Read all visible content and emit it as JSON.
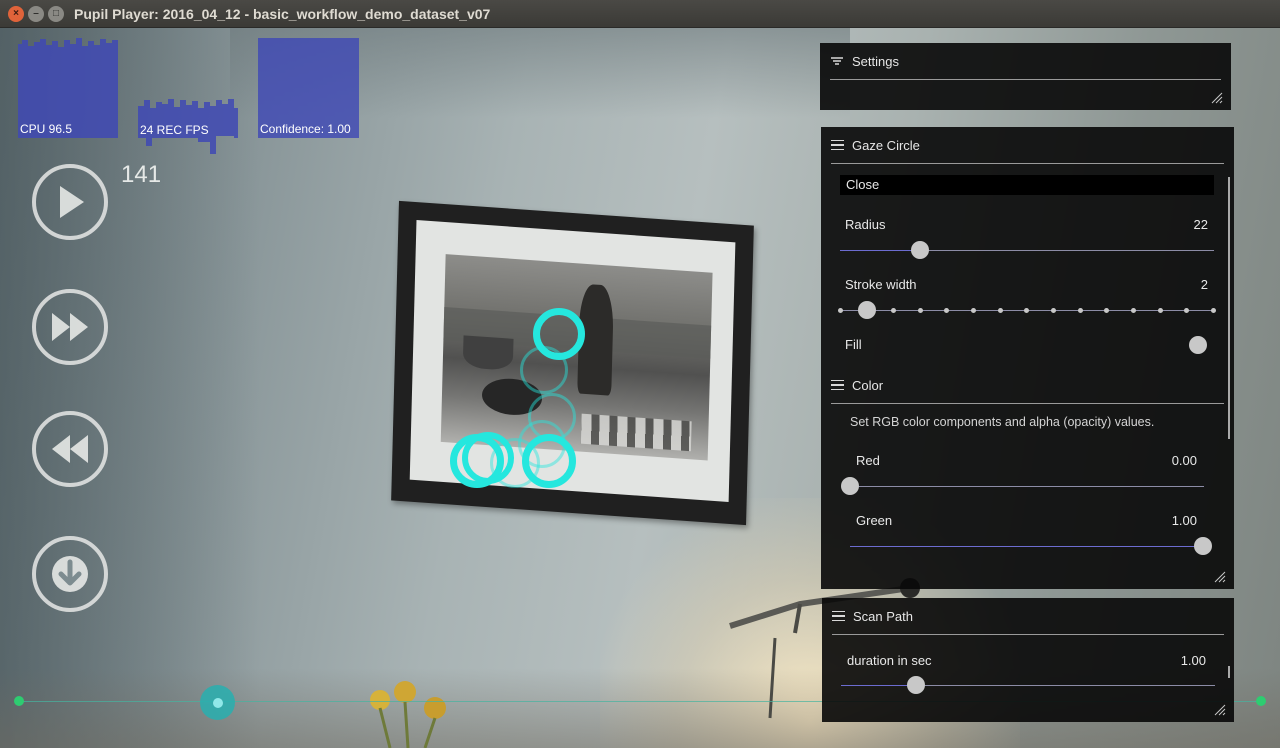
{
  "window": {
    "title": "Pupil Player: 2016_04_12 - basic_workflow_demo_dataset_v07",
    "close_glyph": "×",
    "min_glyph": "–",
    "max_glyph": "□"
  },
  "graphs": {
    "cpu_label": "CPU 96.5",
    "fps_label": "24 REC FPS",
    "confidence_label": "Confidence: 1.00",
    "color": "#4049b4"
  },
  "playback": {
    "frame_number": "141",
    "buttons": [
      "play-icon",
      "fast-forward-icon",
      "rewind-icon",
      "export-download-icon"
    ]
  },
  "seek": {
    "position_fraction": 0.16
  },
  "settings_menu": {
    "title": "Settings"
  },
  "gaze_circle_menu": {
    "title": "Gaze Circle",
    "close_label": "Close",
    "radius_label": "Radius",
    "radius_value": "22",
    "stroke_label": "Stroke width",
    "stroke_value": "2",
    "fill_label": "Fill",
    "color_section_title": "Color",
    "color_description": "Set RGB color components and alpha (opacity) values.",
    "red_label": "Red",
    "red_value": "0.00",
    "green_label": "Green",
    "green_value": "1.00"
  },
  "scan_path_menu": {
    "title": "Scan Path",
    "duration_label": "duration in sec",
    "duration_value": "1.00"
  },
  "accent_color": "#25e7de"
}
